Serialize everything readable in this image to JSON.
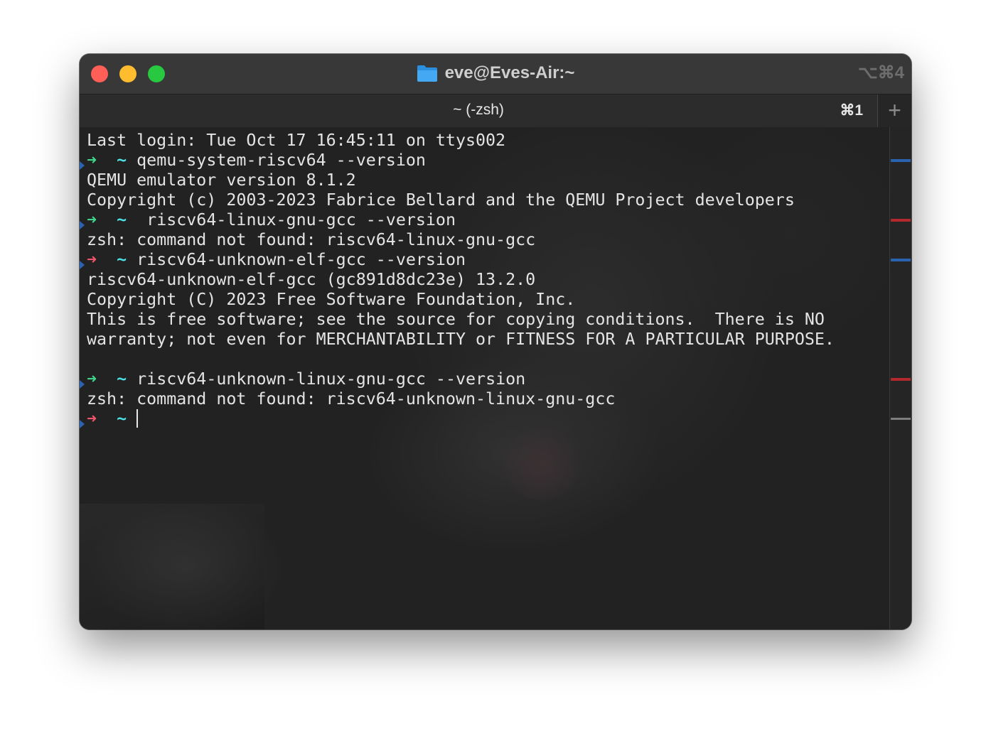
{
  "window": {
    "title": "eve@Eves-Air:~",
    "window_shortcut": "⌥⌘4",
    "title_icon": "folder-icon"
  },
  "tabs": [
    {
      "label": "~ (-zsh)",
      "shortcut": "⌘1"
    }
  ],
  "new_tab": {
    "label": "+"
  },
  "terminal": {
    "lines": [
      {
        "type": "output",
        "text": "Last login: Tue Oct 17 16:45:11 on ttys002"
      },
      {
        "type": "prompt",
        "status": "success",
        "dir": "~",
        "command": "qemu-system-riscv64 --version"
      },
      {
        "type": "output",
        "text": "QEMU emulator version 8.1.2"
      },
      {
        "type": "output",
        "text": "Copyright (c) 2003-2023 Fabrice Bellard and the QEMU Project developers"
      },
      {
        "type": "prompt",
        "status": "success",
        "dir": "~",
        "command": " riscv64-linux-gnu-gcc --version"
      },
      {
        "type": "output",
        "text": "zsh: command not found: riscv64-linux-gnu-gcc"
      },
      {
        "type": "prompt",
        "status": "error",
        "dir": "~",
        "command": "riscv64-unknown-elf-gcc --version"
      },
      {
        "type": "output",
        "text": "riscv64-unknown-elf-gcc (gc891d8dc23e) 13.2.0"
      },
      {
        "type": "output",
        "text": "Copyright (C) 2023 Free Software Foundation, Inc."
      },
      {
        "type": "output",
        "text": "This is free software; see the source for copying conditions.  There is NO"
      },
      {
        "type": "output",
        "text": "warranty; not even for MERCHANTABILITY or FITNESS FOR A PARTICULAR PURPOSE."
      },
      {
        "type": "output",
        "text": ""
      },
      {
        "type": "prompt",
        "status": "success",
        "dir": "~",
        "command": "riscv64-unknown-linux-gnu-gcc --version"
      },
      {
        "type": "output",
        "text": "zsh: command not found: riscv64-unknown-linux-gnu-gcc"
      },
      {
        "type": "prompt",
        "status": "error",
        "dir": "~",
        "command": "",
        "cursor": true
      }
    ],
    "prompt_arrow": "➜",
    "colors": {
      "prompt_success": "#3ed48a",
      "prompt_error": "#f0566a",
      "directory": "#4de1e6",
      "text": "#e4e4e4",
      "mark_command": "#2a63b2",
      "mark_error": "#b3282c"
    }
  },
  "scrollbar_marks": [
    {
      "color": "blue"
    },
    {
      "color": "red"
    },
    {
      "color": "blue"
    },
    {
      "color": "red"
    },
    {
      "color": "gray"
    }
  ]
}
